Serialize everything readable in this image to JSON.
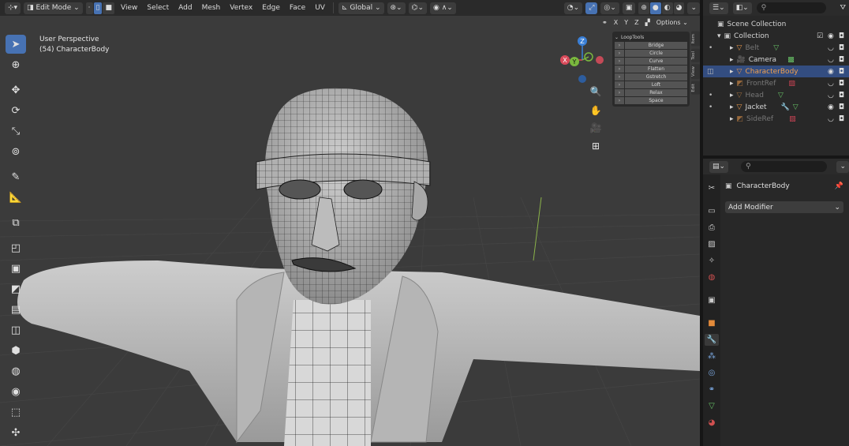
{
  "header": {
    "mode_label": "Edit Mode",
    "menus": [
      "View",
      "Select",
      "Add",
      "Mesh",
      "Vertex",
      "Edge",
      "Face",
      "UV"
    ],
    "transform_orientation": "Global",
    "options_label": "Options"
  },
  "axis_toggles": [
    "X",
    "Y",
    "Z"
  ],
  "viewport": {
    "view_name": "User Perspective",
    "object_info": "(54) CharacterBody"
  },
  "gizmo": {
    "x": "X",
    "y": "Y",
    "z": "Z"
  },
  "loop_tools": {
    "title": "LoopTools",
    "items": [
      "Bridge",
      "Circle",
      "Curve",
      "Flatten",
      "Gstretch",
      "Loft",
      "Relax",
      "Space"
    ]
  },
  "side_tabs": [
    "Item",
    "Tool",
    "View",
    "Edit"
  ],
  "outliner": {
    "scene_collection": "Scene Collection",
    "collection": "Collection",
    "objects": [
      {
        "name": "Belt"
      },
      {
        "name": "Camera"
      },
      {
        "name": "CharacterBody"
      },
      {
        "name": "FrontRef"
      },
      {
        "name": "Head"
      },
      {
        "name": "Jacket"
      },
      {
        "name": "SideRef"
      }
    ]
  },
  "properties": {
    "object_name": "CharacterBody",
    "add_modifier_label": "Add Modifier"
  },
  "colors": {
    "accent": "#4772b3",
    "selected_row": "#334d80",
    "selected_text": "#f0a050",
    "mesh_icon": "#e3954a",
    "data_icon": "#67c066"
  }
}
